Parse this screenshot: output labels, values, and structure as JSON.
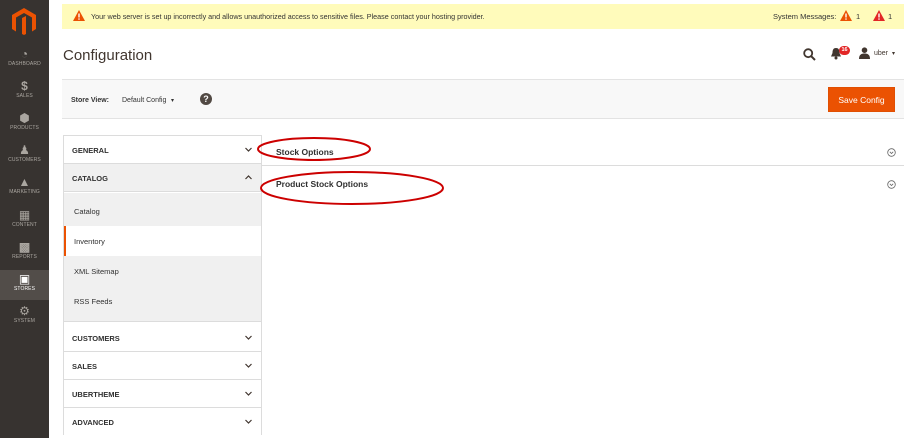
{
  "colors": {
    "menu_bg": "#373330",
    "menu_active": "#524d49",
    "accent": "#eb5202",
    "warning": "#eb5202",
    "message_bg": "#fffbbb",
    "badge": "#e22626",
    "annotation": "#cc0000"
  },
  "admin_menu": {
    "logo": "magento-logo-icon",
    "items": [
      {
        "label": "DASHBOARD",
        "icon": "dashboard-icon"
      },
      {
        "label": "SALES",
        "icon": "dollar-icon"
      },
      {
        "label": "PRODUCTS",
        "icon": "cube-icon"
      },
      {
        "label": "CUSTOMERS",
        "icon": "person-icon"
      },
      {
        "label": "MARKETING",
        "icon": "megaphone-icon"
      },
      {
        "label": "CONTENT",
        "icon": "layout-icon"
      },
      {
        "label": "REPORTS",
        "icon": "bar-chart-icon"
      },
      {
        "label": "STORES",
        "icon": "store-icon"
      },
      {
        "label": "SYSTEM",
        "icon": "gear-icon"
      }
    ],
    "active_index": 7
  },
  "message": {
    "text": "Your web server is set up incorrectly and allows unauthorized access to sensitive files. Please contact your hosting provider.",
    "system_label": "System Messages:",
    "count_1": "1",
    "count_2": "1"
  },
  "header": {
    "title": "Configuration",
    "notifications": "16",
    "user": "uber"
  },
  "toolbar": {
    "store_view_label": "Store View:",
    "store_view_value": "Default Config",
    "help": "?",
    "save_label": "Save Config"
  },
  "tabs": {
    "general": "GENERAL",
    "catalog": "CATALOG",
    "catalog_items": [
      "Catalog",
      "Inventory",
      "XML Sitemap",
      "RSS Feeds"
    ],
    "active_item_index": 1,
    "customers": "CUSTOMERS",
    "sales": "SALES",
    "ubertheme": "UBERTHEME",
    "advanced": "ADVANCED"
  },
  "sections": [
    {
      "title": "Stock Options"
    },
    {
      "title": "Product Stock Options"
    }
  ]
}
